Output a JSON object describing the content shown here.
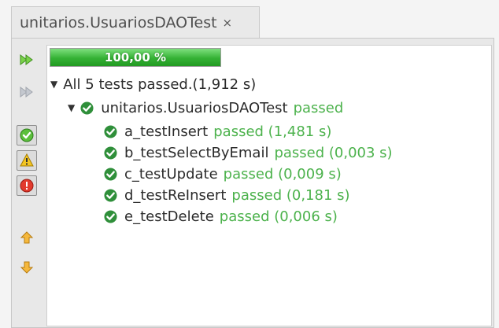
{
  "tab": {
    "title": "unitarios.UsuariosDAOTest",
    "close": "×"
  },
  "progress": {
    "label": "100,00 %",
    "fraction": 1.0
  },
  "summary": "All 5 tests passed.(1,912 s)",
  "suite": {
    "name": "unitarios.UsuariosDAOTest",
    "status": "passed"
  },
  "tests": [
    {
      "name": "a_testInsert",
      "result": "passed (1,481 s)"
    },
    {
      "name": "b_testSelectByEmail",
      "result": "passed (0,003 s)"
    },
    {
      "name": "c_testUpdate",
      "result": "passed (0,009 s)"
    },
    {
      "name": "d_testReInsert",
      "result": "passed (0,181 s)"
    },
    {
      "name": "e_testDelete",
      "result": "passed (0,006 s)"
    }
  ],
  "toolbar": {
    "buttons": [
      "rerun-icon",
      "rerun-failed-icon",
      "show-passed-icon",
      "show-warnings-icon",
      "show-errors-icon",
      "previous-failure-icon",
      "next-failure-icon"
    ]
  },
  "colors": {
    "passed": "#4cb24c",
    "progress": "#34b134"
  }
}
